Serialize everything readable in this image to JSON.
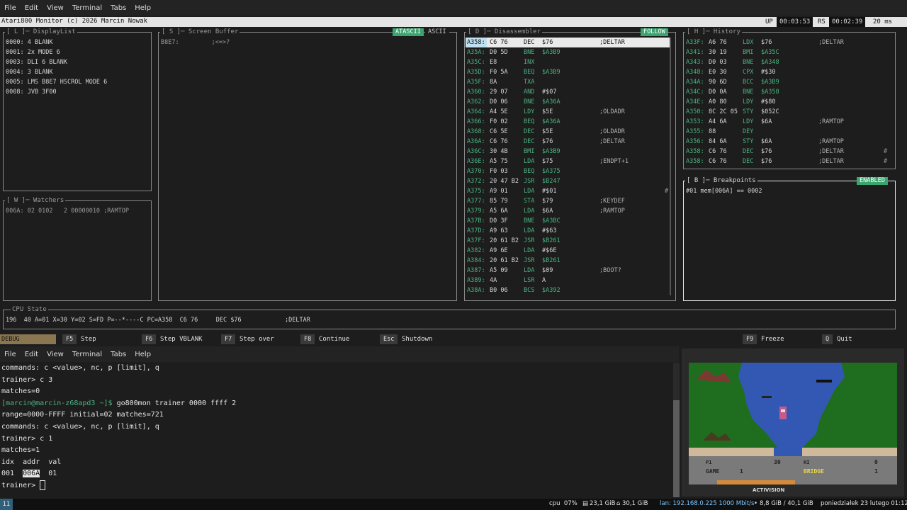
{
  "menus": [
    "File",
    "Edit",
    "View",
    "Terminal",
    "Tabs",
    "Help"
  ],
  "title": {
    "left": "Atari800 Monitor   (c) 2026 Marcin Nowak",
    "up_label": "UP",
    "up_value": "00:03:53",
    "rs_label": "RS",
    "rs_value": "00:02:39",
    "frame_ms": "20 ms"
  },
  "displaylist": {
    "title": "[ L ]─ DisplayList",
    "lines": [
      "0000: 4 BLANK",
      "0001: 2x MODE 6",
      "0003: DLI 6 BLANK",
      "0004: 3 BLANK",
      "0005: LMS B8E7 HSCROL MODE 6",
      "0008: JVB 3F00"
    ]
  },
  "watchers": {
    "title": "[ W ]─ Watchers",
    "line": "006A: 02 0102   2 00000010 ;RAMTOP"
  },
  "screenbuffer": {
    "title": "[ S ]─ Screen Buffer",
    "line": "B8E7:         ;<=>?",
    "tab_atascii": "ATASCII",
    "tab_ascii": "ASCII"
  },
  "disasm": {
    "title": "[ D ]─ Disassembler",
    "follow": "FOLLOW",
    "rows": [
      {
        "addr": "A358:",
        "bytes": "C6 76",
        "op": "DEC",
        "arg": "$76",
        "cmt": ";DELTAR",
        "mark": ""
      },
      {
        "addr": "A35A:",
        "bytes": "D0 5D",
        "op": "BNE",
        "arg": "$A3B9",
        "cmt": "",
        "mark": ""
      },
      {
        "addr": "A35C:",
        "bytes": "E8",
        "op": "INX",
        "arg": "",
        "cmt": "",
        "mark": ""
      },
      {
        "addr": "A35D:",
        "bytes": "F0 5A",
        "op": "BEQ",
        "arg": "$A3B9",
        "cmt": "",
        "mark": ""
      },
      {
        "addr": "A35F:",
        "bytes": "8A",
        "op": "TXA",
        "arg": "",
        "cmt": "",
        "mark": ""
      },
      {
        "addr": "A360:",
        "bytes": "29 07",
        "op": "AND",
        "arg": "#$07",
        "cmt": "",
        "mark": ""
      },
      {
        "addr": "A362:",
        "bytes": "D0 06",
        "op": "BNE",
        "arg": "$A36A",
        "cmt": "",
        "mark": ""
      },
      {
        "addr": "A364:",
        "bytes": "A4 5E",
        "op": "LDY",
        "arg": "$5E",
        "cmt": ";OLDADR",
        "mark": ""
      },
      {
        "addr": "A366:",
        "bytes": "F0 02",
        "op": "BEQ",
        "arg": "$A36A",
        "cmt": "",
        "mark": ""
      },
      {
        "addr": "A368:",
        "bytes": "C6 5E",
        "op": "DEC",
        "arg": "$5E",
        "cmt": ";OLDADR",
        "mark": ""
      },
      {
        "addr": "A36A:",
        "bytes": "C6 76",
        "op": "DEC",
        "arg": "$76",
        "cmt": ";DELTAR",
        "mark": ""
      },
      {
        "addr": "A36C:",
        "bytes": "30 4B",
        "op": "BMI",
        "arg": "$A3B9",
        "cmt": "",
        "mark": ""
      },
      {
        "addr": "A36E:",
        "bytes": "A5 75",
        "op": "LDA",
        "arg": "$75",
        "cmt": ";ENDPT+1",
        "mark": ""
      },
      {
        "addr": "A370:",
        "bytes": "F0 03",
        "op": "BEQ",
        "arg": "$A375",
        "cmt": "",
        "mark": ""
      },
      {
        "addr": "A372:",
        "bytes": "20 47 B2",
        "op": "JSR",
        "arg": "$B247",
        "cmt": "",
        "mark": ""
      },
      {
        "addr": "A375:",
        "bytes": "A9 01",
        "op": "LDA",
        "arg": "#$01",
        "cmt": "",
        "mark": "#"
      },
      {
        "addr": "A377:",
        "bytes": "85 79",
        "op": "STA",
        "arg": "$79",
        "cmt": ";KEYDEF",
        "mark": ""
      },
      {
        "addr": "A379:",
        "bytes": "A5 6A",
        "op": "LDA",
        "arg": "$6A",
        "cmt": ";RAMTOP",
        "mark": ""
      },
      {
        "addr": "A37B:",
        "bytes": "D0 3F",
        "op": "BNE",
        "arg": "$A3BC",
        "cmt": "",
        "mark": ""
      },
      {
        "addr": "A37D:",
        "bytes": "A9 63",
        "op": "LDA",
        "arg": "#$63",
        "cmt": "",
        "mark": ""
      },
      {
        "addr": "A37F:",
        "bytes": "20 61 B2",
        "op": "JSR",
        "arg": "$B261",
        "cmt": "",
        "mark": ""
      },
      {
        "addr": "A382:",
        "bytes": "A9 6E",
        "op": "LDA",
        "arg": "#$6E",
        "cmt": "",
        "mark": ""
      },
      {
        "addr": "A384:",
        "bytes": "20 61 B2",
        "op": "JSR",
        "arg": "$B261",
        "cmt": "",
        "mark": ""
      },
      {
        "addr": "A387:",
        "bytes": "A5 09",
        "op": "LDA",
        "arg": "$09",
        "cmt": ";BOOT?",
        "mark": ""
      },
      {
        "addr": "A389:",
        "bytes": "4A",
        "op": "LSR",
        "arg": "A",
        "cmt": "",
        "mark": ""
      },
      {
        "addr": "A38A:",
        "bytes": "B0 06",
        "op": "BCS",
        "arg": "$A392",
        "cmt": "",
        "mark": ""
      }
    ]
  },
  "history": {
    "title": "[ H ]─ History",
    "rows": [
      {
        "addr": "A33F:",
        "bytes": "A6 76",
        "op": "LDX",
        "arg": "$76",
        "cmt": ";DELTAR",
        "mark": ""
      },
      {
        "addr": "A341:",
        "bytes": "30 19",
        "op": "BMI",
        "arg": "$A35C",
        "cmt": "",
        "mark": ""
      },
      {
        "addr": "A343:",
        "bytes": "D0 03",
        "op": "BNE",
        "arg": "$A348",
        "cmt": "",
        "mark": ""
      },
      {
        "addr": "A348:",
        "bytes": "E0 30",
        "op": "CPX",
        "arg": "#$30",
        "cmt": "",
        "mark": ""
      },
      {
        "addr": "A34A:",
        "bytes": "90 6D",
        "op": "BCC",
        "arg": "$A3B9",
        "cmt": "",
        "mark": ""
      },
      {
        "addr": "A34C:",
        "bytes": "D0 0A",
        "op": "BNE",
        "arg": "$A358",
        "cmt": "",
        "mark": ""
      },
      {
        "addr": "A34E:",
        "bytes": "A0 80",
        "op": "LDY",
        "arg": "#$80",
        "cmt": "",
        "mark": ""
      },
      {
        "addr": "A350:",
        "bytes": "8C 2C 05",
        "op": "STY",
        "arg": "$052C",
        "cmt": "",
        "mark": ""
      },
      {
        "addr": "A353:",
        "bytes": "A4 6A",
        "op": "LDY",
        "arg": "$6A",
        "cmt": ";RAMTOP",
        "mark": ""
      },
      {
        "addr": "A355:",
        "bytes": "88",
        "op": "DEY",
        "arg": "",
        "cmt": "",
        "mark": ""
      },
      {
        "addr": "A356:",
        "bytes": "84 6A",
        "op": "STY",
        "arg": "$6A",
        "cmt": ";RAMTOP",
        "mark": ""
      },
      {
        "addr": "A358:",
        "bytes": "C6 76",
        "op": "DEC",
        "arg": "$76",
        "cmt": ";DELTAR",
        "mark": "#"
      },
      {
        "addr": "A358:",
        "bytes": "C6 76",
        "op": "DEC",
        "arg": "$76",
        "cmt": ";DELTAR",
        "mark": "#"
      }
    ]
  },
  "breakpoints": {
    "title": "[ B ]─ Breakpoints",
    "status": "ENABLED",
    "line": "#01 mem[006A] == 0002"
  },
  "cpu": {
    "title": "CPU State",
    "line": "196  40 A=01 X=30 Y=02 S=FD P=--*----C PC=A358  C6 76     DEC $76            ;DELTAR"
  },
  "fkeys": {
    "mode": "DEBUG",
    "items": [
      {
        "key": "F5",
        "label": "Step"
      },
      {
        "key": "F6",
        "label": "Step VBLANK"
      },
      {
        "key": "F7",
        "label": "Step over"
      },
      {
        "key": "F8",
        "label": "Continue"
      },
      {
        "key": "Esc",
        "label": "Shutdown"
      },
      {
        "key": "F9",
        "label": "Freeze"
      },
      {
        "key": "Q",
        "label": "Quit"
      }
    ]
  },
  "terminal": {
    "lines": [
      "commands: c <value>, nc, p [limit], q",
      "trainer> c 3",
      "matches=0",
      "go800mon trainer 0000 ffff 2",
      "range=0000-FFFF initial=02 matches=721",
      "commands: c <value>, nc, p [limit], q",
      "trainer> c 1",
      "matches=1",
      "idx  addr  val",
      "01",
      "trainer> "
    ],
    "prompt": "[marcin@marcin-z68apd3 ~]$",
    "row_idx": "001",
    "row_addr": "006A"
  },
  "game": {
    "p1_label": "P1",
    "p1_score": "30",
    "hi_label": "HI",
    "hi_score": "0",
    "game_label": "GAME",
    "game_num": "1",
    "bridge_label": "BRIDGE",
    "bridge_num": "1",
    "brand": "ACTIVISION"
  },
  "taskbar": {
    "workspace": "11",
    "cpu": "cpu  07%",
    "mem1": "23,1 GiB",
    "mem2": "30,1 GiB",
    "lan": "lan: 192.168.0.225 1000 Mbit/s",
    "disk": "8,8 GiB / 40,1 GiB",
    "date": "poniedziałek 23 lutego 01:12"
  }
}
